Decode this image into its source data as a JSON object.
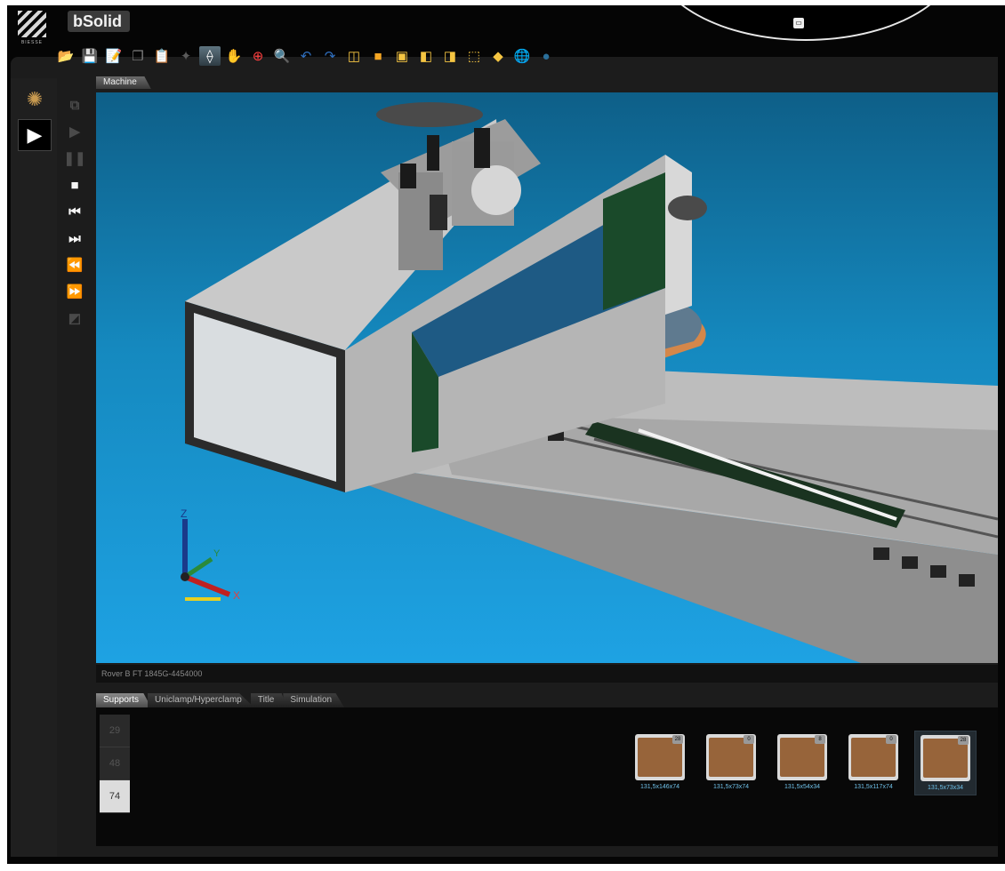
{
  "app": {
    "title": "bSolid",
    "logo_text": "BIESSE"
  },
  "hud": {
    "icon": "printer-icon"
  },
  "toolbar": [
    {
      "name": "open-folder-icon",
      "glyph": "📂",
      "color": "#f2c94c"
    },
    {
      "name": "save-icon",
      "glyph": "💾",
      "color": "#8fb8e0"
    },
    {
      "name": "edit-icon",
      "glyph": "📝",
      "color": "#f0d060"
    },
    {
      "name": "copy-icon",
      "glyph": "❐",
      "color": "#7f7f7f"
    },
    {
      "name": "paste-icon",
      "glyph": "📋",
      "color": "#8a7a5a"
    },
    {
      "name": "sparkle-icon",
      "glyph": "✦",
      "color": "#5a5a5a"
    },
    {
      "name": "measure-icon",
      "glyph": "⟠",
      "color": "#ffffff",
      "active": true
    },
    {
      "name": "pan-hand-icon",
      "glyph": "✋",
      "color": "#ffffff"
    },
    {
      "name": "zoom-fit-icon",
      "glyph": "⊕",
      "color": "#ff4040"
    },
    {
      "name": "zoom-icon",
      "glyph": "🔍",
      "color": "#a05050"
    },
    {
      "name": "undo-icon",
      "glyph": "↶",
      "color": "#3070c0"
    },
    {
      "name": "redo-icon",
      "glyph": "↷",
      "color": "#3070c0"
    },
    {
      "name": "view-iso-icon",
      "glyph": "◫",
      "color": "#f5c542"
    },
    {
      "name": "view-front-icon",
      "glyph": "■",
      "color": "#f5a623"
    },
    {
      "name": "view-top-icon",
      "glyph": "▣",
      "color": "#f5c542"
    },
    {
      "name": "view-left-icon",
      "glyph": "◧",
      "color": "#f5c542"
    },
    {
      "name": "view-right-icon",
      "glyph": "◨",
      "color": "#f5c542"
    },
    {
      "name": "view-wire-icon",
      "glyph": "⬚",
      "color": "#f5c542"
    },
    {
      "name": "diamond-icon",
      "glyph": "◆",
      "color": "#f5c542"
    },
    {
      "name": "globe-icon",
      "glyph": "🌐",
      "color": "#40a0d0"
    },
    {
      "name": "sphere-icon",
      "glyph": "●",
      "color": "#2a6f9a"
    }
  ],
  "rail": [
    {
      "name": "machine-assembly-icon",
      "glyph": "✺",
      "color": "#c89a50"
    },
    {
      "name": "play-panel-icon",
      "glyph": "▶",
      "color": "#ffffff",
      "active": true
    }
  ],
  "controls": [
    {
      "name": "fit-icon",
      "glyph": "⧉",
      "dim": true
    },
    {
      "name": "play-icon",
      "glyph": "▶",
      "dim": true
    },
    {
      "name": "pause-icon",
      "glyph": "❚❚",
      "dim": true
    },
    {
      "name": "stop-icon",
      "glyph": "■"
    },
    {
      "name": "step-back-icon",
      "glyph": "⏮"
    },
    {
      "name": "step-forward-icon",
      "glyph": "⏭"
    },
    {
      "name": "fast-rewind-icon",
      "glyph": "⏪"
    },
    {
      "name": "fast-forward-icon",
      "glyph": "⏩"
    },
    {
      "name": "clip-icon",
      "glyph": "◩",
      "dim": true
    }
  ],
  "viewport": {
    "tab": "Machine",
    "status": "Rover B FT 1845G-4454000",
    "axes": {
      "x": "X",
      "y": "Y",
      "z": "Z"
    }
  },
  "bottom_tabs": [
    "Supports",
    "Uniclamp/Hyperclamp",
    "Title",
    "Simulation"
  ],
  "bottom_tabs_active": 0,
  "numbers": [
    "29",
    "48",
    "74"
  ],
  "numbers_selected": 2,
  "supports": [
    {
      "label": "131,5x146x74",
      "badge": "28"
    },
    {
      "label": "131,5x73x74",
      "badge": "0"
    },
    {
      "label": "131,5x54x34",
      "badge": "8"
    },
    {
      "label": "131,5x117x74",
      "badge": "0"
    },
    {
      "label": "131,5x73x34",
      "badge": "28"
    }
  ],
  "supports_selected": 4
}
